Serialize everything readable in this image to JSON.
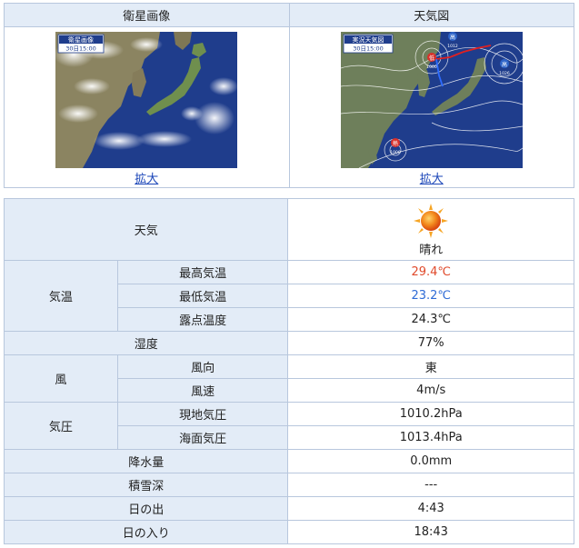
{
  "maps": {
    "satellite": {
      "header": "衛星画像",
      "badge_title": "衛星画像",
      "badge_time": "30日15:00",
      "link": "拡大"
    },
    "weather_map": {
      "header": "天気図",
      "badge_title": "実況天気図",
      "badge_time": "30日15:00",
      "link": "拡大",
      "pressure_labels": [
        "低",
        "高",
        "高",
        "熱"
      ],
      "pressure_values": [
        "1000",
        "1012",
        "1026",
        "1000"
      ]
    }
  },
  "details": {
    "weather": {
      "label": "天気",
      "value": "晴れ",
      "icon": "sun-icon"
    },
    "temperature": {
      "group_label": "気温",
      "max": {
        "label": "最高気温",
        "value": "29.4℃",
        "color": "#e04a2b"
      },
      "min": {
        "label": "最低気温",
        "value": "23.2℃",
        "color": "#2e6bd6"
      },
      "dew": {
        "label": "露点温度",
        "value": "24.3℃"
      }
    },
    "humidity": {
      "label": "湿度",
      "value": "77%"
    },
    "wind": {
      "group_label": "風",
      "direction": {
        "label": "風向",
        "value": "東"
      },
      "speed": {
        "label": "風速",
        "value": "4m/s"
      }
    },
    "pressure": {
      "group_label": "気圧",
      "station": {
        "label": "現地気圧",
        "value": "1010.2hPa"
      },
      "sea": {
        "label": "海面気圧",
        "value": "1013.4hPa"
      }
    },
    "precipitation": {
      "label": "降水量",
      "value": "0.0mm"
    },
    "snow_depth": {
      "label": "積雪深",
      "value": "---"
    },
    "sunrise": {
      "label": "日の出",
      "value": "4:43"
    },
    "sunset": {
      "label": "日の入り",
      "value": "18:43"
    }
  }
}
